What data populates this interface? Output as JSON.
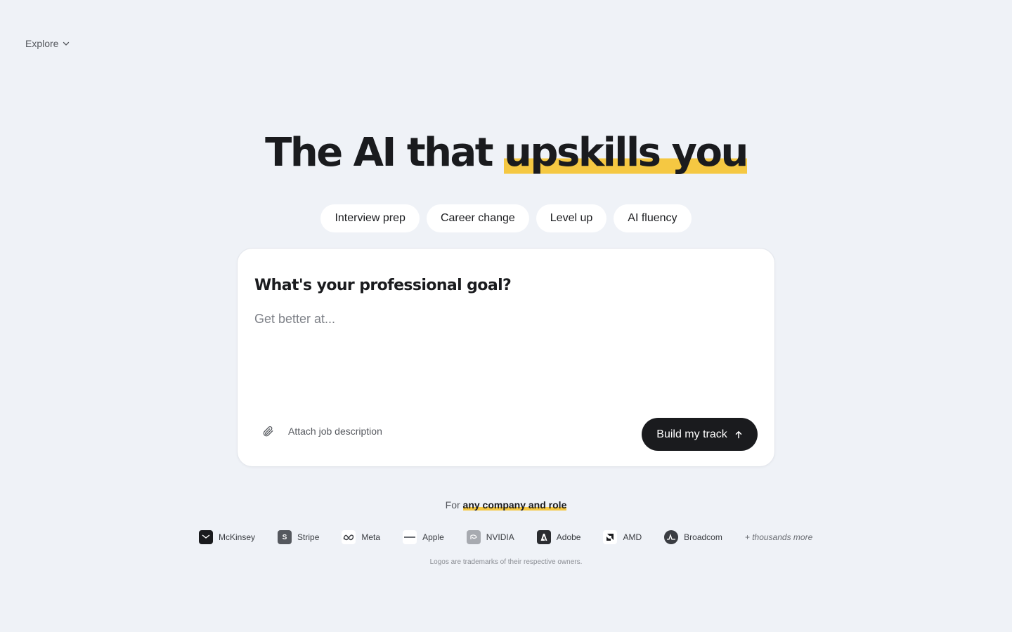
{
  "nav": {
    "explore_label": "Explore"
  },
  "hero": {
    "title_prefix": "The AI that ",
    "title_highlight": "upskills you"
  },
  "pills": [
    {
      "label": "Interview prep"
    },
    {
      "label": "Career change"
    },
    {
      "label": "Level up"
    },
    {
      "label": "AI fluency"
    }
  ],
  "goal_card": {
    "question": "What's your professional goal?",
    "input_placeholder": "Get better at...",
    "input_value": "",
    "attach_label": "Attach job description",
    "submit_label": "Build my track"
  },
  "companies": {
    "for_prefix": "For ",
    "for_highlight": "any company and role",
    "items": [
      {
        "name": "McKinsey",
        "icon": "mckinsey-logo",
        "color": "#1a1b1e"
      },
      {
        "name": "Stripe",
        "icon": "stripe-logo",
        "color": "#55585e"
      },
      {
        "name": "Meta",
        "icon": "meta-logo",
        "color": "#ffffff"
      },
      {
        "name": "Apple",
        "icon": "apple-logo",
        "color": "#ffffff"
      },
      {
        "name": "NVIDIA",
        "icon": "nvidia-logo",
        "color": "#8b8e94"
      },
      {
        "name": "Adobe",
        "icon": "adobe-logo",
        "color": "#2b2d31"
      },
      {
        "name": "AMD",
        "icon": "amd-logo",
        "color": "#ffffff"
      },
      {
        "name": "Broadcom",
        "icon": "broadcom-logo",
        "color": "#3a3d42"
      }
    ],
    "more_label": "+ thousands more",
    "disclaimer": "Logos are trademarks of their respective owners."
  }
}
